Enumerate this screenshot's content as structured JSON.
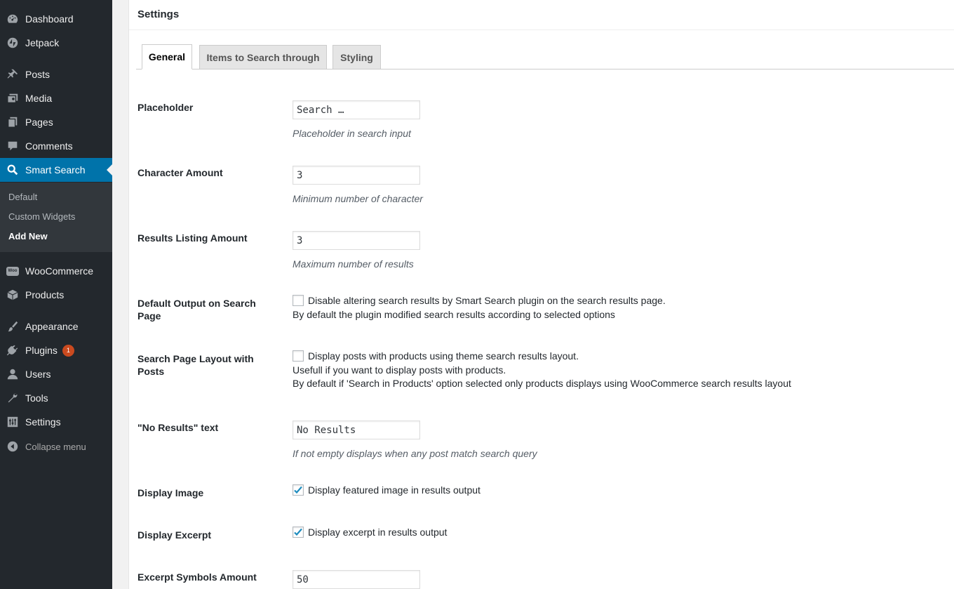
{
  "sidebar": {
    "items": [
      {
        "label": "Dashboard",
        "icon": "dashboard-icon"
      },
      {
        "label": "Jetpack",
        "icon": "jetpack-icon"
      },
      {
        "label": "Posts",
        "icon": "pin-icon"
      },
      {
        "label": "Media",
        "icon": "media-icon"
      },
      {
        "label": "Pages",
        "icon": "pages-icon"
      },
      {
        "label": "Comments",
        "icon": "comment-icon"
      },
      {
        "label": "Smart Search",
        "icon": "search-icon"
      },
      {
        "label": "WooCommerce",
        "icon": "woocommerce-icon"
      },
      {
        "label": "Products",
        "icon": "products-icon"
      },
      {
        "label": "Appearance",
        "icon": "brush-icon"
      },
      {
        "label": "Plugins",
        "icon": "plugin-icon",
        "badge": "1"
      },
      {
        "label": "Users",
        "icon": "user-icon"
      },
      {
        "label": "Tools",
        "icon": "wrench-icon"
      },
      {
        "label": "Settings",
        "icon": "settings-icon"
      },
      {
        "label": "Collapse menu",
        "icon": "collapse-icon"
      }
    ],
    "submenu": [
      "Default",
      "Custom Widgets",
      "Add New"
    ],
    "woo_icon_text": "Woo"
  },
  "panel": {
    "title": "Settings",
    "tabs": [
      "General",
      "Items to Search through",
      "Styling"
    ]
  },
  "fields": {
    "placeholder": {
      "label": "Placeholder",
      "value": "Search …",
      "desc": "Placeholder in search input"
    },
    "char_amount": {
      "label": "Character Amount",
      "value": "3",
      "desc": "Minimum number of character"
    },
    "results_amount": {
      "label": "Results Listing Amount",
      "value": "3",
      "desc": "Maximum number of results"
    },
    "default_output": {
      "label": "Default Output on Search Page",
      "checkbox_label": "Disable altering search results by Smart Search plugin on the search results page.",
      "checked": false,
      "note": "By default the plugin modified search results according to selected options"
    },
    "page_layout": {
      "label": "Search Page Layout with Posts",
      "checkbox_label": "Display posts with products using theme search results layout.",
      "checked": false,
      "note1": "Usefull if you want to display posts with products.",
      "note2": "By default if 'Search in Products' option selected only products displays using WooCommerce search results layout"
    },
    "no_results": {
      "label": "\"No Results\" text",
      "value": "No Results",
      "desc": "If not empty displays when any post match search query"
    },
    "display_image": {
      "label": "Display Image",
      "checkbox_label": "Display featured image in results output",
      "checked": true
    },
    "display_excerpt": {
      "label": "Display Excerpt",
      "checkbox_label": "Display excerpt in results output",
      "checked": true
    },
    "excerpt_symbols": {
      "label": "Excerpt Symbols Amount",
      "value": "50"
    }
  },
  "colors": {
    "sidebar_bg": "#23282d",
    "accent": "#0073aa",
    "badge": "#ca4a1f"
  }
}
